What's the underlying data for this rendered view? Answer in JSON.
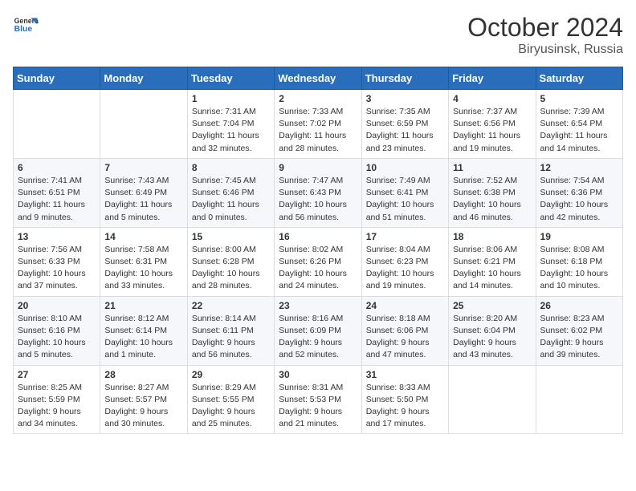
{
  "header": {
    "logo_general": "General",
    "logo_blue": "Blue",
    "month": "October 2024",
    "location": "Biryusinsk, Russia"
  },
  "days_of_week": [
    "Sunday",
    "Monday",
    "Tuesday",
    "Wednesday",
    "Thursday",
    "Friday",
    "Saturday"
  ],
  "weeks": [
    [
      {
        "day": "",
        "info": ""
      },
      {
        "day": "",
        "info": ""
      },
      {
        "day": "1",
        "info": "Sunrise: 7:31 AM\nSunset: 7:04 PM\nDaylight: 11 hours and 32 minutes."
      },
      {
        "day": "2",
        "info": "Sunrise: 7:33 AM\nSunset: 7:02 PM\nDaylight: 11 hours and 28 minutes."
      },
      {
        "day": "3",
        "info": "Sunrise: 7:35 AM\nSunset: 6:59 PM\nDaylight: 11 hours and 23 minutes."
      },
      {
        "day": "4",
        "info": "Sunrise: 7:37 AM\nSunset: 6:56 PM\nDaylight: 11 hours and 19 minutes."
      },
      {
        "day": "5",
        "info": "Sunrise: 7:39 AM\nSunset: 6:54 PM\nDaylight: 11 hours and 14 minutes."
      }
    ],
    [
      {
        "day": "6",
        "info": "Sunrise: 7:41 AM\nSunset: 6:51 PM\nDaylight: 11 hours and 9 minutes."
      },
      {
        "day": "7",
        "info": "Sunrise: 7:43 AM\nSunset: 6:49 PM\nDaylight: 11 hours and 5 minutes."
      },
      {
        "day": "8",
        "info": "Sunrise: 7:45 AM\nSunset: 6:46 PM\nDaylight: 11 hours and 0 minutes."
      },
      {
        "day": "9",
        "info": "Sunrise: 7:47 AM\nSunset: 6:43 PM\nDaylight: 10 hours and 56 minutes."
      },
      {
        "day": "10",
        "info": "Sunrise: 7:49 AM\nSunset: 6:41 PM\nDaylight: 10 hours and 51 minutes."
      },
      {
        "day": "11",
        "info": "Sunrise: 7:52 AM\nSunset: 6:38 PM\nDaylight: 10 hours and 46 minutes."
      },
      {
        "day": "12",
        "info": "Sunrise: 7:54 AM\nSunset: 6:36 PM\nDaylight: 10 hours and 42 minutes."
      }
    ],
    [
      {
        "day": "13",
        "info": "Sunrise: 7:56 AM\nSunset: 6:33 PM\nDaylight: 10 hours and 37 minutes."
      },
      {
        "day": "14",
        "info": "Sunrise: 7:58 AM\nSunset: 6:31 PM\nDaylight: 10 hours and 33 minutes."
      },
      {
        "day": "15",
        "info": "Sunrise: 8:00 AM\nSunset: 6:28 PM\nDaylight: 10 hours and 28 minutes."
      },
      {
        "day": "16",
        "info": "Sunrise: 8:02 AM\nSunset: 6:26 PM\nDaylight: 10 hours and 24 minutes."
      },
      {
        "day": "17",
        "info": "Sunrise: 8:04 AM\nSunset: 6:23 PM\nDaylight: 10 hours and 19 minutes."
      },
      {
        "day": "18",
        "info": "Sunrise: 8:06 AM\nSunset: 6:21 PM\nDaylight: 10 hours and 14 minutes."
      },
      {
        "day": "19",
        "info": "Sunrise: 8:08 AM\nSunset: 6:18 PM\nDaylight: 10 hours and 10 minutes."
      }
    ],
    [
      {
        "day": "20",
        "info": "Sunrise: 8:10 AM\nSunset: 6:16 PM\nDaylight: 10 hours and 5 minutes."
      },
      {
        "day": "21",
        "info": "Sunrise: 8:12 AM\nSunset: 6:14 PM\nDaylight: 10 hours and 1 minute."
      },
      {
        "day": "22",
        "info": "Sunrise: 8:14 AM\nSunset: 6:11 PM\nDaylight: 9 hours and 56 minutes."
      },
      {
        "day": "23",
        "info": "Sunrise: 8:16 AM\nSunset: 6:09 PM\nDaylight: 9 hours and 52 minutes."
      },
      {
        "day": "24",
        "info": "Sunrise: 8:18 AM\nSunset: 6:06 PM\nDaylight: 9 hours and 47 minutes."
      },
      {
        "day": "25",
        "info": "Sunrise: 8:20 AM\nSunset: 6:04 PM\nDaylight: 9 hours and 43 minutes."
      },
      {
        "day": "26",
        "info": "Sunrise: 8:23 AM\nSunset: 6:02 PM\nDaylight: 9 hours and 39 minutes."
      }
    ],
    [
      {
        "day": "27",
        "info": "Sunrise: 8:25 AM\nSunset: 5:59 PM\nDaylight: 9 hours and 34 minutes."
      },
      {
        "day": "28",
        "info": "Sunrise: 8:27 AM\nSunset: 5:57 PM\nDaylight: 9 hours and 30 minutes."
      },
      {
        "day": "29",
        "info": "Sunrise: 8:29 AM\nSunset: 5:55 PM\nDaylight: 9 hours and 25 minutes."
      },
      {
        "day": "30",
        "info": "Sunrise: 8:31 AM\nSunset: 5:53 PM\nDaylight: 9 hours and 21 minutes."
      },
      {
        "day": "31",
        "info": "Sunrise: 8:33 AM\nSunset: 5:50 PM\nDaylight: 9 hours and 17 minutes."
      },
      {
        "day": "",
        "info": ""
      },
      {
        "day": "",
        "info": ""
      }
    ]
  ]
}
